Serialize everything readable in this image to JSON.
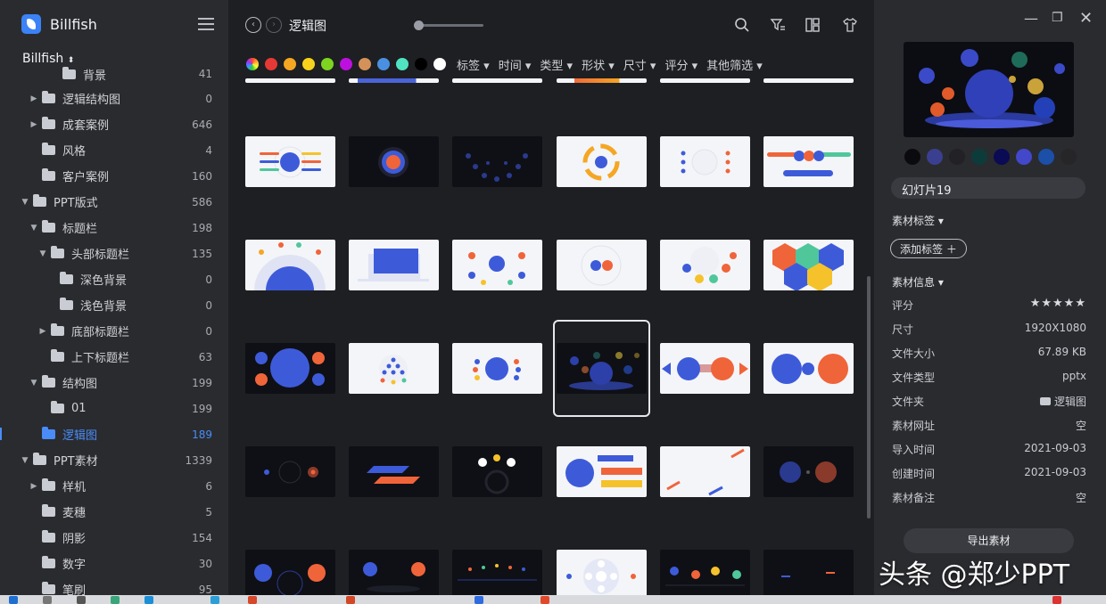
{
  "app": {
    "name": "Billfish",
    "library": "Billfish"
  },
  "sidebar": {
    "items": [
      {
        "label": "背景",
        "count": "41"
      },
      {
        "label": "逻辑结构图",
        "count": "0"
      },
      {
        "label": "成套案例",
        "count": "646"
      },
      {
        "label": "风格",
        "count": "4"
      },
      {
        "label": "客户案例",
        "count": "160"
      },
      {
        "label": "PPT版式",
        "count": "586"
      },
      {
        "label": "标题栏",
        "count": "198"
      },
      {
        "label": "头部标题栏",
        "count": "135"
      },
      {
        "label": "深色背景",
        "count": "0"
      },
      {
        "label": "浅色背景",
        "count": "0"
      },
      {
        "label": "底部标题栏",
        "count": "0"
      },
      {
        "label": "上下标题栏",
        "count": "63"
      },
      {
        "label": "结构图",
        "count": "199"
      },
      {
        "label": "01",
        "count": "199"
      },
      {
        "label": "逻辑图",
        "count": "189"
      },
      {
        "label": "PPT素材",
        "count": "1339"
      },
      {
        "label": "样机",
        "count": "6"
      },
      {
        "label": "麦穗",
        "count": "5"
      },
      {
        "label": "阴影",
        "count": "154"
      },
      {
        "label": "数字",
        "count": "30"
      },
      {
        "label": "笔刷",
        "count": "95"
      }
    ]
  },
  "main": {
    "folder_title": "逻辑图",
    "colors": [
      "#e53935",
      "#f5a623",
      "#f7d21c",
      "#7ed321",
      "#bd10e0",
      "#d4915a",
      "#4a90e2",
      "#50e3c2",
      "#000000",
      "#ffffff"
    ],
    "filters": [
      "标签",
      "时间",
      "类型",
      "形状",
      "尺寸",
      "评分",
      "其他筛选"
    ]
  },
  "panel": {
    "palette": [
      "#0b0b0f",
      "#3b3f8f",
      "#222226",
      "#0d3b3a",
      "#0a0a55",
      "#4347c9",
      "#1b4fa8",
      "#262629"
    ],
    "file_name": "幻灯片19",
    "tags_title": "素材标签",
    "add_tag": "添加标签 ＋",
    "info_title": "素材信息",
    "rating_label": "评分",
    "rating": 5,
    "stars": "★★★★★",
    "info": [
      {
        "k": "尺寸",
        "v": "1920X1080"
      },
      {
        "k": "文件大小",
        "v": "67.89 KB"
      },
      {
        "k": "文件类型",
        "v": "pptx"
      },
      {
        "k": "文件夹",
        "v": "逻辑图"
      },
      {
        "k": "素材网址",
        "v": "空"
      },
      {
        "k": "导入时间",
        "v": "2021-09-03"
      },
      {
        "k": "创建时间",
        "v": "2021-09-03"
      },
      {
        "k": "素材备注",
        "v": "空"
      }
    ],
    "export": "导出素材"
  },
  "watermark": "头条 @郑少PPT"
}
